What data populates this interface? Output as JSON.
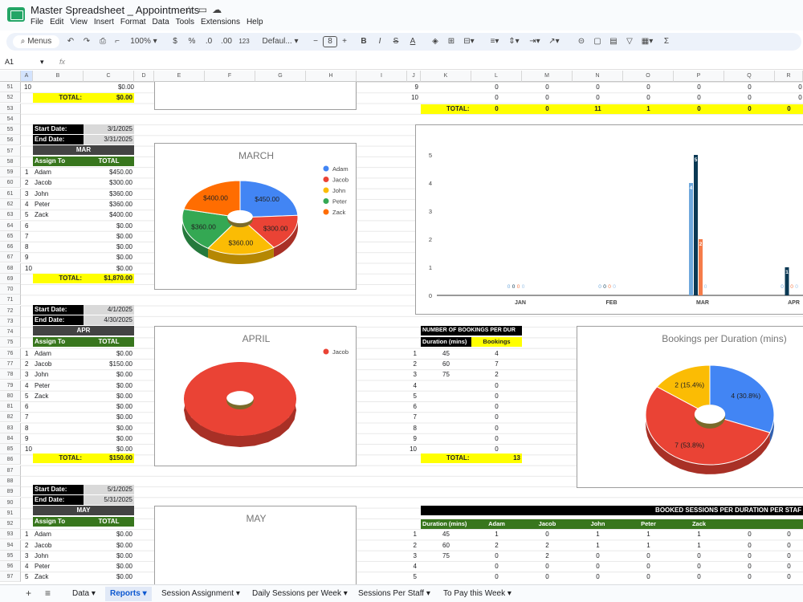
{
  "app": {
    "title": "Master Spreadsheet _ Appointments",
    "title_icons": [
      "star-icon",
      "folder-icon",
      "cloud-icon"
    ],
    "menu": [
      "File",
      "Edit",
      "View",
      "Insert",
      "Format",
      "Data",
      "Tools",
      "Extensions",
      "Help"
    ]
  },
  "toolbar": {
    "menus": "Menus",
    "zoom": "100%",
    "currency": "$",
    "percent": "%",
    "dec_less": ".0",
    "dec_more": ".00",
    "format_123": "123",
    "font": "Defaul...",
    "font_size": "8"
  },
  "formula_bar": {
    "cell": "A1",
    "fx": "fx"
  },
  "columns": [
    "A",
    "B",
    "C",
    "D",
    "E",
    "F",
    "G",
    "H",
    "I",
    "J",
    "K",
    "L",
    "M",
    "N",
    "O",
    "P",
    "Q",
    "R"
  ],
  "rows": [
    "51",
    "52",
    "53",
    "54",
    "55",
    "56",
    "57",
    "58",
    "59",
    "60",
    "61",
    "62",
    "63",
    "64",
    "65",
    "66",
    "67",
    "68",
    "69",
    "70",
    "71",
    "72",
    "73",
    "74",
    "75",
    "76",
    "77",
    "78",
    "79",
    "80",
    "81",
    "82",
    "83",
    "84",
    "85",
    "86",
    "87",
    "88",
    "89",
    "90",
    "91",
    "92",
    "93",
    "94",
    "95",
    "96",
    "97"
  ],
  "left": {
    "top": {
      "n10": "10",
      "v10": "$0.00",
      "total_label": "TOTAL:",
      "total": "$0.00"
    },
    "march": {
      "start_label": "Start Date:",
      "start": "3/1/2025",
      "end_label": "End Date:",
      "end": "3/31/2025",
      "month": "MAR",
      "h1": "Assign To",
      "h2": "TOTAL",
      "rows": [
        [
          "1",
          "Adam",
          "$450.00"
        ],
        [
          "2",
          "Jacob",
          "$300.00"
        ],
        [
          "3",
          "John",
          "$360.00"
        ],
        [
          "4",
          "Peter",
          "$360.00"
        ],
        [
          "5",
          "Zack",
          "$400.00"
        ],
        [
          "6",
          "",
          "$0.00"
        ],
        [
          "7",
          "",
          "$0.00"
        ],
        [
          "8",
          "",
          "$0.00"
        ],
        [
          "9",
          "",
          "$0.00"
        ],
        [
          "10",
          "",
          "$0.00"
        ]
      ],
      "total_label": "TOTAL:",
      "total": "$1,870.00"
    },
    "april": {
      "start_label": "Start Date:",
      "start": "4/1/2025",
      "end_label": "End Date:",
      "end": "4/30/2025",
      "month": "APR",
      "h1": "Assign To",
      "h2": "TOTAL",
      "rows": [
        [
          "1",
          "Adam",
          "$0.00"
        ],
        [
          "2",
          "Jacob",
          "$150.00"
        ],
        [
          "3",
          "John",
          "$0.00"
        ],
        [
          "4",
          "Peter",
          "$0.00"
        ],
        [
          "5",
          "Zack",
          "$0.00"
        ],
        [
          "6",
          "",
          "$0.00"
        ],
        [
          "7",
          "",
          "$0.00"
        ],
        [
          "8",
          "",
          "$0.00"
        ],
        [
          "9",
          "",
          "$0.00"
        ],
        [
          "10",
          "",
          "$0.00"
        ]
      ],
      "total_label": "TOTAL:",
      "total": "$150.00"
    },
    "may": {
      "start_label": "Start Date:",
      "start": "5/1/2025",
      "end_label": "End Date:",
      "end": "5/31/2025",
      "month": "MAY",
      "h1": "Assign To",
      "h2": "TOTAL",
      "rows": [
        [
          "1",
          "Adam",
          "$0.00"
        ],
        [
          "2",
          "Jacob",
          "$0.00"
        ],
        [
          "3",
          "John",
          "$0.00"
        ],
        [
          "4",
          "Peter",
          "$0.00"
        ],
        [
          "5",
          "Zack",
          "$0.00"
        ]
      ]
    }
  },
  "right_top": {
    "rows": [
      [
        "9",
        "0",
        "0",
        "0",
        "0",
        "0",
        "0",
        "0"
      ],
      [
        "10",
        "0",
        "0",
        "0",
        "0",
        "0",
        "0",
        "0"
      ]
    ],
    "total_label": "TOTAL:",
    "totals": [
      "0",
      "0",
      "11",
      "1",
      "0",
      "0",
      "0"
    ]
  },
  "durations": {
    "title": "NUMBER OF BOOKINGS PER DUR",
    "h1": "Duration (mins)",
    "h2": "Bookings",
    "rows": [
      [
        "1",
        "45",
        "4"
      ],
      [
        "2",
        "60",
        "7"
      ],
      [
        "3",
        "75",
        "2"
      ],
      [
        "4",
        "",
        "0"
      ],
      [
        "5",
        "",
        "0"
      ],
      [
        "6",
        "",
        "0"
      ],
      [
        "7",
        "",
        "0"
      ],
      [
        "8",
        "",
        "0"
      ],
      [
        "9",
        "",
        "0"
      ],
      [
        "10",
        "",
        "0"
      ]
    ],
    "total_label": "TOTAL:",
    "total": "13"
  },
  "booked": {
    "title": "BOOKED SESSIONS PER DURATION PER STAF",
    "headers": [
      "Duration (mins)",
      "Adam",
      "Jacob",
      "John",
      "Peter",
      "Zack",
      "",
      ""
    ],
    "rows": [
      [
        "1",
        "45",
        "1",
        "0",
        "1",
        "1",
        "1",
        "0",
        "0"
      ],
      [
        "2",
        "60",
        "2",
        "2",
        "1",
        "1",
        "1",
        "0",
        "0"
      ],
      [
        "3",
        "75",
        "0",
        "2",
        "0",
        "0",
        "0",
        "0",
        "0"
      ],
      [
        "4",
        "",
        "0",
        "0",
        "0",
        "0",
        "0",
        "0",
        "0"
      ],
      [
        "5",
        "",
        "0",
        "0",
        "0",
        "0",
        "0",
        "0",
        "0"
      ]
    ]
  },
  "chart_data": [
    {
      "type": "pie",
      "title": "MARCH",
      "categories": [
        "Adam",
        "Jacob",
        "John",
        "Peter",
        "Zack"
      ],
      "values": [
        450,
        300,
        360,
        360,
        400
      ],
      "labels": [
        "$450.00",
        "$300.00",
        "$360.00",
        "$360.00",
        "$400.00"
      ],
      "colors": [
        "#4285f4",
        "#ea4335",
        "#fbbc04",
        "#34a853",
        "#ff6d01"
      ],
      "legend": "right"
    },
    {
      "type": "pie",
      "title": "APRIL",
      "categories": [
        "Jacob"
      ],
      "values": [
        150
      ],
      "colors": [
        "#ea4335"
      ],
      "legend": "right"
    },
    {
      "type": "pie",
      "title": "MAY",
      "categories": [],
      "values": []
    },
    {
      "type": "pie",
      "title": "Bookings per Duration (mins)",
      "categories": [
        "45",
        "60",
        "75"
      ],
      "values": [
        4,
        7,
        2
      ],
      "labels": [
        "4 (30.8%)",
        "7 (53.8%)",
        "2 (15.4%)"
      ],
      "colors": [
        "#4285f4",
        "#ea4335",
        "#fbbc04"
      ]
    },
    {
      "type": "bar",
      "categories": [
        "JAN",
        "FEB",
        "MAR",
        "APR"
      ],
      "ylim": [
        0,
        5
      ],
      "yticks": [
        "0",
        "1",
        "2",
        "3",
        "4",
        "5"
      ],
      "series": [
        {
          "color": "#6fa8dc",
          "values": [
            0,
            0,
            4,
            0
          ]
        },
        {
          "color": "#0b3954",
          "values": [
            0,
            0,
            5,
            1
          ]
        },
        {
          "color": "#f57c4a",
          "values": [
            0,
            0,
            2,
            0
          ]
        },
        {
          "color": "#9fc5e8",
          "values": [
            0,
            0,
            0,
            0
          ]
        }
      ]
    }
  ]
}
